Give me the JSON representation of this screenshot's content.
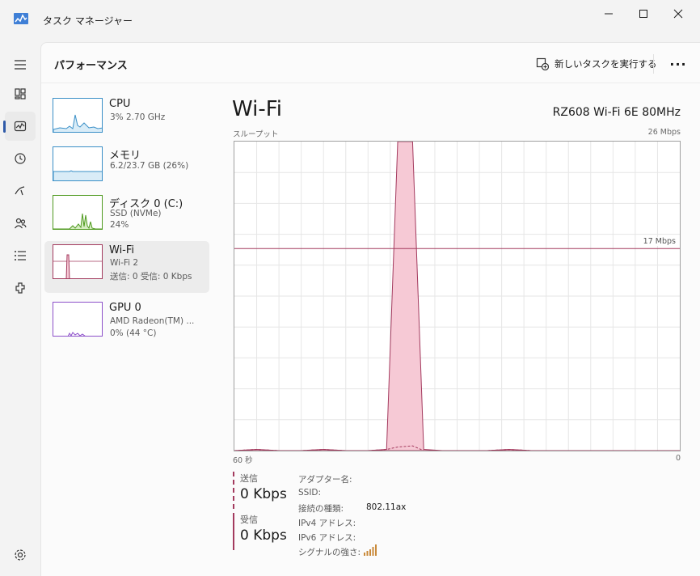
{
  "window": {
    "title": "タスク マネージャー"
  },
  "header": {
    "page_title": "パフォーマンス",
    "run_task_label": "新しいタスクを実行する",
    "more_label": "···"
  },
  "devices": [
    {
      "name": "CPU",
      "sub1": "3%  2.70 GHz",
      "sub2": ""
    },
    {
      "name": "メモリ",
      "sub1": "6.2/23.7 GB (26%)",
      "sub2": ""
    },
    {
      "name": "ディスク 0 (C:)",
      "sub1": "SSD (NVMe)",
      "sub2": "24%"
    },
    {
      "name": "Wi-Fi",
      "sub1": "Wi-Fi 2",
      "sub2": "送信: 0 受信: 0 Kbps"
    },
    {
      "name": "GPU 0",
      "sub1": "AMD Radeon(TM) ...",
      "sub2": "0%  (44 °C)"
    }
  ],
  "detail": {
    "title": "Wi-Fi",
    "adapter": "RZ608 Wi-Fi 6E 80MHz",
    "axis_top_left": "スループット",
    "axis_top_right": "26 Mbps",
    "axis_bottom_left": "60 秒",
    "axis_bottom_right": "0",
    "marker_label": "17 Mbps"
  },
  "stats": {
    "send_label": "送信",
    "send_value": "0 Kbps",
    "recv_label": "受信",
    "recv_value": "0 Kbps"
  },
  "properties": [
    {
      "label": "アダプター名:",
      "value": ""
    },
    {
      "label": "SSID:",
      "value": ""
    },
    {
      "label": "接続の種類:",
      "value": "802.11ax"
    },
    {
      "label": "IPv4 アドレス:",
      "value": ""
    },
    {
      "label": "IPv6 アドレス:",
      "value": ""
    },
    {
      "label": "シグナルの強さ:",
      "value": ""
    }
  ],
  "chart_data": {
    "type": "area",
    "ylabel": "スループット",
    "ylim": [
      0,
      26
    ],
    "y_unit": "Mbps",
    "x_range_seconds": [
      60,
      0
    ],
    "marker": 17,
    "x": [
      60,
      57,
      54,
      51,
      48,
      45,
      42,
      39.5,
      38,
      36,
      34.5,
      32,
      29,
      26,
      23,
      20,
      17,
      14,
      11,
      8,
      5,
      2,
      0
    ],
    "series": [
      {
        "name": "送信",
        "values": [
          0,
          0.1,
          0,
          0,
          0.1,
          0,
          0,
          0.1,
          0.3,
          0.4,
          0,
          0,
          0,
          0,
          0.1,
          0,
          0,
          0,
          0,
          0,
          0,
          0,
          0
        ]
      },
      {
        "name": "受信",
        "values": [
          0,
          0.1,
          0,
          0,
          0.1,
          0,
          0,
          0.1,
          26,
          26,
          0.1,
          0,
          0,
          0,
          0.1,
          0,
          0,
          0,
          0,
          0,
          0,
          0,
          0
        ]
      }
    ],
    "colors": {
      "line": "#a33a5e",
      "fill": "#f6c9d5",
      "grid": "#e6e6e6"
    },
    "grid": true
  }
}
